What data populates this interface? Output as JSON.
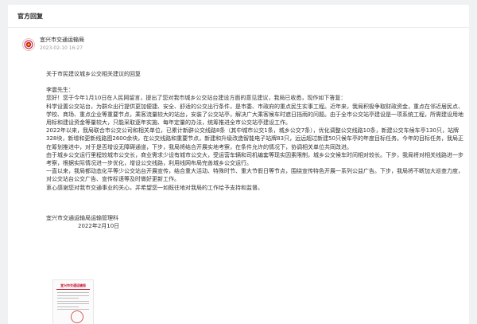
{
  "header": {
    "title": "官方回复"
  },
  "reply": {
    "sender": "宜兴市交通运输局",
    "time": "2023-02-10 16:27",
    "title": "关于市民建议城乡公交相关建议的回复",
    "salutation": "李震先生：",
    "paragraphs": [
      "您好！您于今年1月10日在人民网留言，提出了您对我市城乡公交站台建设方面的意见建议，我局已收悉，现作如下答复：",
      "科学设置公交站台，为群众出行提供更加便捷、安全、舒适的公交出行条件，是市委、市政府的重点民生实事工程。近年来，我局积极争取财政资金，重点在邻近居民点、学校、商场、重点企业等重要节点，乘客流量较大的站台，安装了公交站亭，解决广大乘客候车时遮日挡雨的问题。由于全市公交站亭建设是一项系统工程，所需建设用地用标和建设资金等量较大，只能采取逐年实施、每年定量的办法，统筹推进全市公交站亭建设工作。",
      "2022年以来，我局联合市公交公司和相关单位，已累计新辟公交线路8条（其中城市公交1条，城乡公交7条），优化调整公交线路10条，新建公交车候车亭130只，站牌328块，新增和更新线路图2600余块，在公交线路和重要节点，新建和升级改造智能电子站牌83只，远远超过新建50只候车亭的年度目标任务。今年的目标任务，我局正在筹划推进中，对于是否增设无障碍通道，下步，我局将结合开展实地考察，在条件允许的情况下，协调相关单位共同改进。",
      "由于城乡公交运行里程较城市公交长，商业需求少设有城市公交大，受运营车辆和司机编套等现实因素限制，城乡公交候车时间相对较长。下步，我局将对相关线路进一步考察，根据实际情况进一步优化，增设公交线路，利用线网布局完善城乡公交运行。",
      "一直以来，我局都动态化平等少公交站台开展宣传，结合重大活动、特殊时节、重大节假日等节点，围绕宣传特色开展一系列公益广告。下步，我局将不断加大巡查力度，对公交站台公交广告、宣传标语等及时做好更新工作。",
      "衷心感谢您对我市交通事业的关心，并希望您一如既往地对我局的工作给予支持和监督。"
    ],
    "signature": "宜兴市交通运输局运输管理科",
    "date": "2022年2月10日",
    "attachment": {
      "header": "宜兴市交通运输局"
    }
  },
  "colors": {
    "page_bg": "#f0f1f3",
    "card_bg": "#ffffff",
    "text": "#333333",
    "muted": "#999999",
    "accent": "#c8102e"
  },
  "icons": {
    "avatar": "government-emblem-icon"
  }
}
